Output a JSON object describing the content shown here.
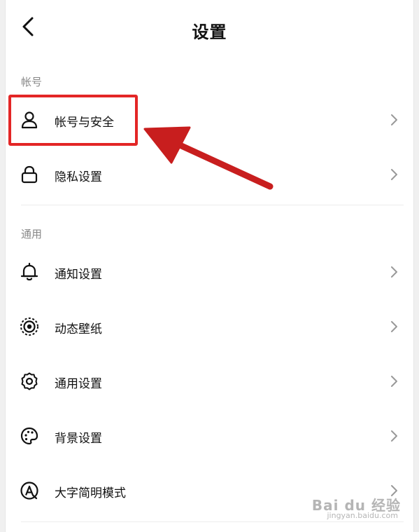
{
  "header": {
    "title": "设置"
  },
  "sections": {
    "account": {
      "title": "帐号",
      "items": [
        {
          "label": "帐号与安全",
          "icon": "user-icon"
        },
        {
          "label": "隐私设置",
          "icon": "lock-icon"
        }
      ]
    },
    "general": {
      "title": "通用",
      "items": [
        {
          "label": "通知设置",
          "icon": "bell-icon"
        },
        {
          "label": "动态壁纸",
          "icon": "live-wallpaper-icon"
        },
        {
          "label": "通用设置",
          "icon": "gear-icon"
        },
        {
          "label": "背景设置",
          "icon": "palette-icon"
        },
        {
          "label": "大字简明模式",
          "icon": "large-font-icon"
        }
      ]
    }
  },
  "watermark": {
    "line1": "Bai du 经验",
    "line2": "jingyan.baidu.com"
  },
  "colors": {
    "highlight": "#e32626",
    "arrow": "#c81e1e"
  }
}
